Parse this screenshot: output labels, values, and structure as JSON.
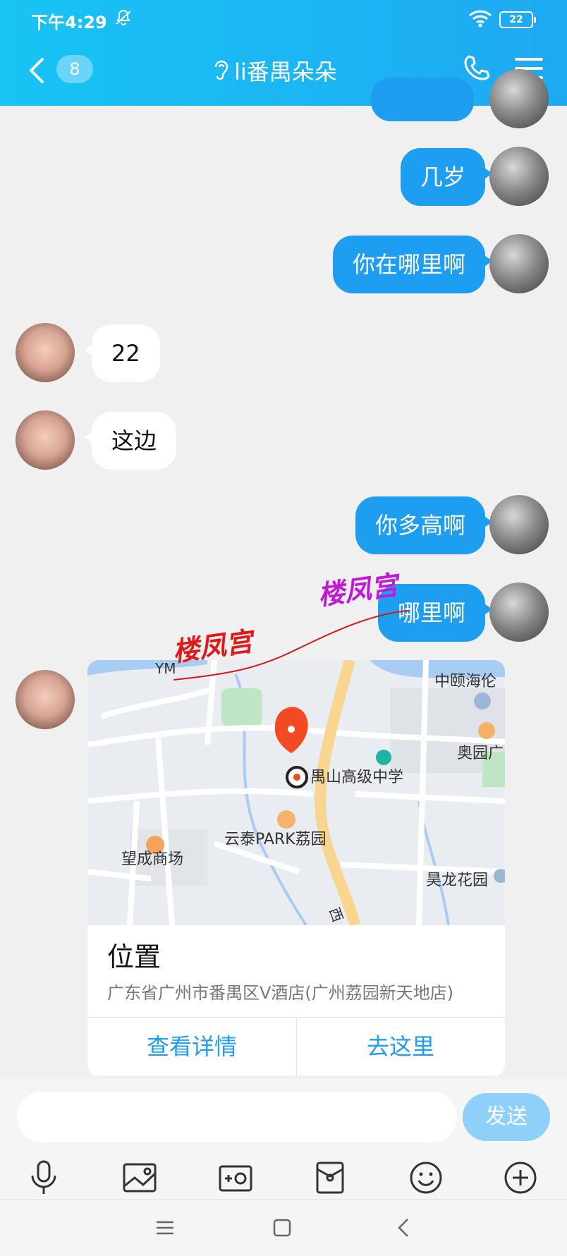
{
  "status": {
    "time": "下午4:29",
    "battery": "22"
  },
  "header": {
    "unread": "8",
    "title": "li番禺朵朵"
  },
  "messages": {
    "m1": "几岁",
    "m2": "你在哪里啊",
    "m3": "22",
    "m4": "这边",
    "m5": "你多高啊",
    "m6": "哪里啊"
  },
  "location_card": {
    "map_labels": {
      "poi1": "中颐海伦",
      "poi2": "奥园广",
      "poi3": "禺山高级中学",
      "poi4": "云泰PARK荔园",
      "poi5": "望成商场",
      "poi6": "昊龙花园",
      "poi7": "YM",
      "road": "西"
    },
    "title": "位置",
    "address": "广东省广州市番禺区V酒店(广州荔园新天地店)",
    "detail_button": "查看详情",
    "go_button": "去这里"
  },
  "watermarks": [
    "楼凤宫",
    "楼凤宫"
  ],
  "input": {
    "placeholder": "",
    "send_label": "发送"
  },
  "colors": {
    "header": "#1ea9f2",
    "bubble_out": "#1e9ef0",
    "accent": "#1e9ef0"
  }
}
